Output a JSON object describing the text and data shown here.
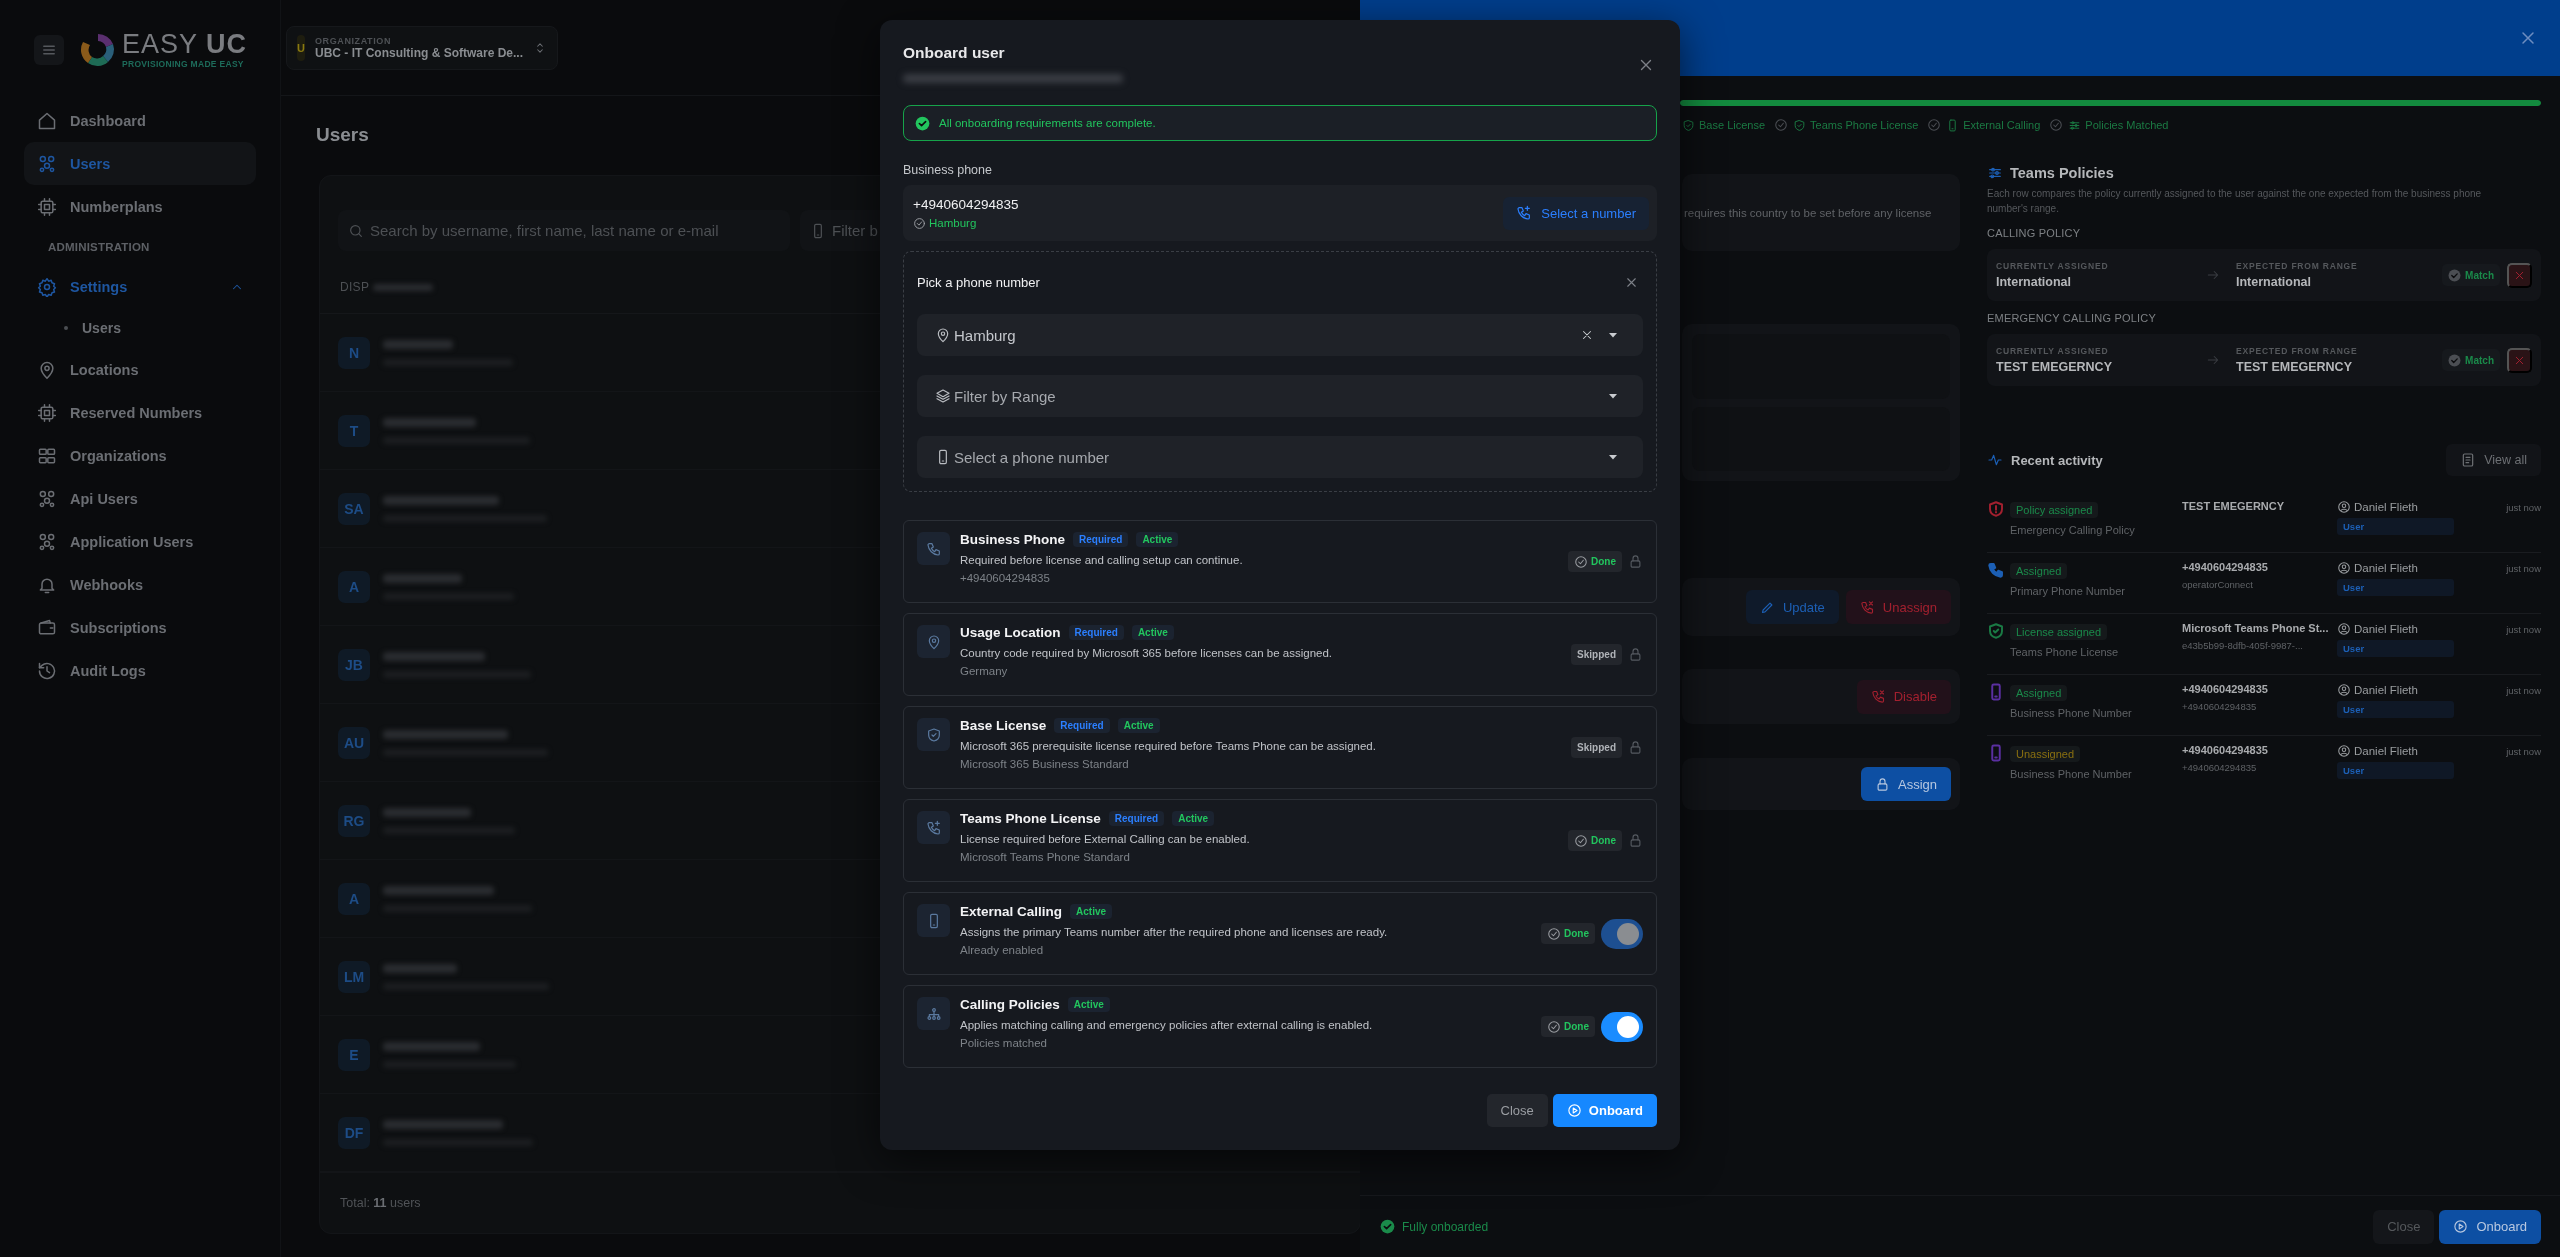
{
  "sidebar": {
    "logo": {
      "wordmark": "EASY **UC**",
      "tagline": "PROVISIONING MADE EASY"
    },
    "nav": [
      {
        "kind": "link",
        "label": "Dashboard",
        "selected": false
      },
      {
        "kind": "link",
        "label": "Users",
        "selected": true
      },
      {
        "kind": "link",
        "label": "Numberplans",
        "selected": false
      },
      {
        "kind": "heading",
        "label": "ADMINISTRATION"
      },
      {
        "kind": "group",
        "label": "Settings",
        "active": true,
        "expanded": true
      },
      {
        "kind": "sub",
        "label": "Users",
        "selected": false
      },
      {
        "kind": "link",
        "label": "Locations",
        "selected": false
      },
      {
        "kind": "link",
        "label": "Reserved Numbers",
        "selected": false
      },
      {
        "kind": "link",
        "label": "Organizations",
        "selected": false
      },
      {
        "kind": "link",
        "label": "Api Users",
        "selected": false
      },
      {
        "kind": "link",
        "label": "Application Users",
        "selected": false
      },
      {
        "kind": "link",
        "label": "Webhooks",
        "selected": false
      },
      {
        "kind": "link",
        "label": "Subscriptions",
        "selected": false
      },
      {
        "kind": "link",
        "label": "Audit Logs",
        "selected": false
      }
    ]
  },
  "main": {
    "organization": {
      "badge": "U",
      "label": "ORGANIZATION",
      "name": "UBC - IT Consulting & Software De..."
    },
    "title": "Users",
    "search": {
      "placeholder": "Search by username, first name, last name or e-mail"
    },
    "filter": {
      "placeholder": "Filter b"
    },
    "table": {
      "columns": [
        "DISP"
      ],
      "rows": [
        {
          "initials": "N"
        },
        {
          "initials": "T"
        },
        {
          "initials": "SA"
        },
        {
          "initials": "A"
        },
        {
          "initials": "JB"
        },
        {
          "initials": "AU"
        },
        {
          "initials": "RG"
        },
        {
          "initials": "A"
        },
        {
          "initials": "LM"
        },
        {
          "initials": "E"
        },
        {
          "initials": "DF"
        }
      ]
    },
    "footer": "Total: **11** users"
  },
  "drawer": {
    "progress": {
      "level": 1
    },
    "steps": [
      {
        "label": "Base License"
      },
      {
        "label": "Teams Phone License",
        "done": true
      },
      {
        "label": "External Calling",
        "done": true
      },
      {
        "label": "Policies Matched",
        "done": true
      }
    ],
    "usage_note": "requires this country to be set before any license",
    "phone_actions": [
      {
        "label": "Update",
        "kind": "primary"
      },
      {
        "label": "Unassign",
        "kind": "danger"
      }
    ],
    "calling_actions": [
      {
        "label": "Disable",
        "kind": "danger"
      }
    ],
    "policy_actions": [
      {
        "label": "Assign",
        "kind": "solid"
      }
    ],
    "teams_policies": {
      "title": "Teams Policies",
      "description": "Each row compares the policy currently assigned to the user against the one expected from the business phone number's range.",
      "groups": [
        {
          "heading": "CALLING POLICY",
          "current_label": "CURRENTLY ASSIGNED",
          "current": "International",
          "expected_label": "EXPECTED FROM RANGE",
          "expected": "International",
          "status": "Match",
          "match": true
        },
        {
          "heading": "EMERGENCY CALLING POLICY",
          "current_label": "CURRENTLY ASSIGNED",
          "current": "TEST EMEGERNCY",
          "expected_label": "EXPECTED FROM RANGE",
          "expected": "TEST EMEGERNCY",
          "status": "Match",
          "match": true
        }
      ]
    },
    "recent_activity": {
      "title": "Recent activity",
      "view_all": "View all",
      "items": [
        {
          "kind": "policy",
          "color": "#a3202f",
          "badge": {
            "label": "Policy assigned",
            "color": "#1a8a4a"
          },
          "subject": "Emergency Calling Policy",
          "value": "TEST EMEGERNCY",
          "actor": "Daniel Flieth",
          "role": "User",
          "time": "just now"
        },
        {
          "kind": "phone",
          "color": "#1c5fb5",
          "badge": {
            "label": "Assigned",
            "color": "#1a8a4a"
          },
          "subject": "Primary Phone Number",
          "value": "+4940604294835",
          "detail": "operatorConnect",
          "actor": "Daniel Flieth",
          "role": "User",
          "time": "just now"
        },
        {
          "kind": "license",
          "color": "#1a7a44",
          "badge": {
            "label": "License assigned",
            "color": "#1a8a4a"
          },
          "subject": "Teams Phone License",
          "value": "Microsoft Teams Phone St...",
          "detail": "e43b5b99-8dfb-405f-9987-...",
          "actor": "Daniel Flieth",
          "role": "User",
          "time": "just now"
        },
        {
          "kind": "device",
          "color": "#5a2fa0",
          "badge": {
            "label": "Assigned",
            "color": "#1a8a4a"
          },
          "subject": "Business Phone Number",
          "value": "+4940604294835",
          "detail": "+4940604294835",
          "actor": "Daniel Flieth",
          "role": "User",
          "time": "just now"
        },
        {
          "kind": "device",
          "color": "#5a2fa0",
          "badge": {
            "label": "Unassigned",
            "color": "#8a7010"
          },
          "subject": "Business Phone Number",
          "value": "+4940604294835",
          "detail": "+4940604294835",
          "actor": "Daniel Flieth",
          "role": "User",
          "time": "just now"
        }
      ]
    },
    "footer": {
      "status": "Fully onboarded",
      "buttons": [
        {
          "label": "Close",
          "kind": "secondary"
        },
        {
          "label": "Onboard",
          "kind": "primary"
        }
      ]
    }
  },
  "modal": {
    "title": "Onboard user",
    "banner": "All onboarding requirements are complete.",
    "phone_label": "Business phone",
    "phone": {
      "number": "+4940604294835",
      "location": "Hamburg",
      "action": "Select a number"
    },
    "picker": {
      "title": "Pick a phone number",
      "fields": [
        {
          "kind": "location",
          "value": "Hamburg",
          "clearable": true
        },
        {
          "kind": "range",
          "placeholder": "Filter by Range",
          "clearable": false
        },
        {
          "kind": "number",
          "placeholder": "Select a phone number",
          "clearable": false
        }
      ]
    },
    "steps": [
      {
        "kind": "locked",
        "title": "Business Phone",
        "badges": [
          {
            "label": "Required",
            "color": "#2b7fff"
          },
          {
            "label": "Active",
            "color": "#22c55e"
          }
        ],
        "description": "Required before license and calling setup can continue.",
        "detail": "+4940604294835",
        "status": {
          "label": "Done",
          "complete": true
        }
      },
      {
        "kind": "locked",
        "title": "Usage Location",
        "badges": [
          {
            "label": "Required",
            "color": "#2b7fff"
          },
          {
            "label": "Active",
            "color": "#22c55e"
          }
        ],
        "description": "Country code required by Microsoft 365 before licenses can be assigned.",
        "detail": "Germany",
        "status": {
          "label": "Skipped",
          "complete": false
        }
      },
      {
        "kind": "locked",
        "title": "Base License",
        "badges": [
          {
            "label": "Required",
            "color": "#2b7fff"
          },
          {
            "label": "Active",
            "color": "#22c55e"
          }
        ],
        "description": "Microsoft 365 prerequisite license required before Teams Phone can be assigned.",
        "detail": "Microsoft 365 Business Standard",
        "status": {
          "label": "Skipped",
          "complete": false
        }
      },
      {
        "kind": "locked",
        "title": "Teams Phone License",
        "badges": [
          {
            "label": "Required",
            "color": "#2b7fff"
          },
          {
            "label": "Active",
            "color": "#22c55e"
          }
        ],
        "description": "License required before External Calling can be enabled.",
        "detail": "Microsoft Teams Phone Standard",
        "status": {
          "label": "Done",
          "complete": true
        }
      },
      {
        "kind": "toggle",
        "title": "External Calling",
        "badges": [
          {
            "label": "Active",
            "color": "#22c55e"
          }
        ],
        "description": "Assigns the primary Teams number after the required phone and licenses are ready.",
        "detail": "Already enabled",
        "status": {
          "label": "Done",
          "complete": true
        },
        "on": true,
        "disabled": true
      },
      {
        "kind": "toggle",
        "title": "Calling Policies",
        "badges": [
          {
            "label": "Active",
            "color": "#22c55e"
          }
        ],
        "description": "Applies matching calling and emergency policies after external calling is enabled.",
        "detail": "Policies matched",
        "status": {
          "label": "Done",
          "complete": true
        },
        "on": true,
        "disabled": false
      }
    ],
    "buttons": [
      {
        "label": "Close",
        "kind": "secondary"
      },
      {
        "label": "Onboard",
        "kind": "primary"
      }
    ]
  }
}
